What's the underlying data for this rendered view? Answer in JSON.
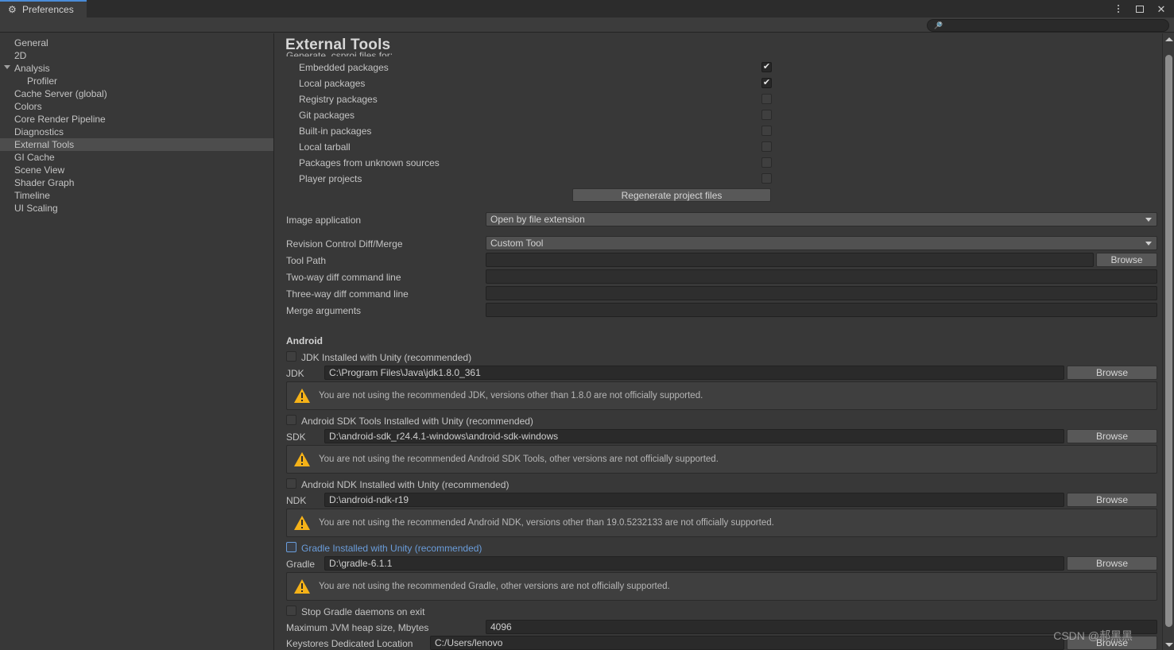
{
  "window": {
    "tab_label": "Preferences",
    "tab_icon": "gear-icon",
    "controls": {
      "menu": "kebab-menu-icon",
      "maximize": "maximize-icon",
      "close": "close-icon"
    }
  },
  "search": {
    "placeholder": "",
    "value": "",
    "icon": "search-icon"
  },
  "sidebar": {
    "items": [
      {
        "label": "General",
        "indent": false,
        "selected": false,
        "arrow": false
      },
      {
        "label": "2D",
        "indent": false,
        "selected": false,
        "arrow": false
      },
      {
        "label": "Analysis",
        "indent": false,
        "selected": false,
        "arrow": true
      },
      {
        "label": "Profiler",
        "indent": true,
        "selected": false,
        "arrow": false
      },
      {
        "label": "Cache Server (global)",
        "indent": false,
        "selected": false,
        "arrow": false
      },
      {
        "label": "Colors",
        "indent": false,
        "selected": false,
        "arrow": false
      },
      {
        "label": "Core Render Pipeline",
        "indent": false,
        "selected": false,
        "arrow": false
      },
      {
        "label": "Diagnostics",
        "indent": false,
        "selected": false,
        "arrow": false
      },
      {
        "label": "External Tools",
        "indent": false,
        "selected": true,
        "arrow": false
      },
      {
        "label": "GI Cache",
        "indent": false,
        "selected": false,
        "arrow": false
      },
      {
        "label": "Scene View",
        "indent": false,
        "selected": false,
        "arrow": false
      },
      {
        "label": "Shader Graph",
        "indent": false,
        "selected": false,
        "arrow": false
      },
      {
        "label": "Timeline",
        "indent": false,
        "selected": false,
        "arrow": false
      },
      {
        "label": "UI Scaling",
        "indent": false,
        "selected": false,
        "arrow": false
      }
    ]
  },
  "main": {
    "title": "External Tools",
    "csproj_label": "Generate .csproj files for:",
    "csproj_options": [
      {
        "label": "Embedded packages",
        "checked": true
      },
      {
        "label": "Local packages",
        "checked": true
      },
      {
        "label": "Registry packages",
        "checked": false
      },
      {
        "label": "Git packages",
        "checked": false
      },
      {
        "label": "Built-in packages",
        "checked": false
      },
      {
        "label": "Local tarball",
        "checked": false
      },
      {
        "label": "Packages from unknown sources",
        "checked": false
      },
      {
        "label": "Player projects",
        "checked": false
      }
    ],
    "regenerate_button": "Regenerate project files",
    "image_application": {
      "label": "Image application",
      "value": "Open by file extension"
    },
    "revision_control": {
      "label": "Revision Control Diff/Merge",
      "value": "Custom Tool"
    },
    "tool_path": {
      "label": "Tool Path",
      "value": "",
      "browse": "Browse"
    },
    "two_way": {
      "label": "Two-way diff command line",
      "value": ""
    },
    "three_way": {
      "label": "Three-way diff command line",
      "value": ""
    },
    "merge_args": {
      "label": "Merge arguments",
      "value": ""
    },
    "android": {
      "section": "Android",
      "jdk": {
        "checkbox_label": "JDK Installed with Unity (recommended)",
        "checked": false,
        "field_label": "JDK",
        "value": "C:\\Program Files\\Java\\jdk1.8.0_361",
        "browse": "Browse",
        "warning": "You are not using the recommended JDK, versions other than 1.8.0 are not officially supported."
      },
      "sdk": {
        "checkbox_label": "Android SDK Tools Installed with Unity (recommended)",
        "checked": false,
        "field_label": "SDK",
        "value": "D:\\android-sdk_r24.4.1-windows\\android-sdk-windows",
        "browse": "Browse",
        "warning": "You are not using the recommended Android SDK Tools, other versions are not officially supported."
      },
      "ndk": {
        "checkbox_label": "Android NDK Installed with Unity (recommended)",
        "checked": false,
        "field_label": "NDK",
        "value": "D:\\android-ndk-r19",
        "browse": "Browse",
        "warning": "You are not using the recommended Android NDK, versions other than 19.0.5232133 are not officially supported."
      },
      "gradle": {
        "checkbox_label": "Gradle Installed with Unity (recommended)",
        "checked": false,
        "focused": true,
        "field_label": "Gradle",
        "value": "D:\\gradle-6.1.1",
        "browse": "Browse",
        "warning": "You are not using the recommended Gradle, other versions are not officially supported."
      },
      "stop_daemons": {
        "label": "Stop Gradle daemons on exit",
        "checked": false
      },
      "jvm_heap": {
        "label": "Maximum JVM heap size, Mbytes",
        "value": "4096"
      },
      "keystores": {
        "label": "Keystores Dedicated Location",
        "value": "C:/Users/lenovo",
        "browse": "Browse"
      }
    }
  },
  "scrollbar": {
    "up": "scroll-up-arrow",
    "down": "scroll-down-arrow"
  },
  "watermark": "CSDN @郝黑黑",
  "colors": {
    "accent": "#4a8cd8",
    "warning": "#f5b218",
    "panel": "#383838",
    "selected": "#4d4d4d"
  }
}
